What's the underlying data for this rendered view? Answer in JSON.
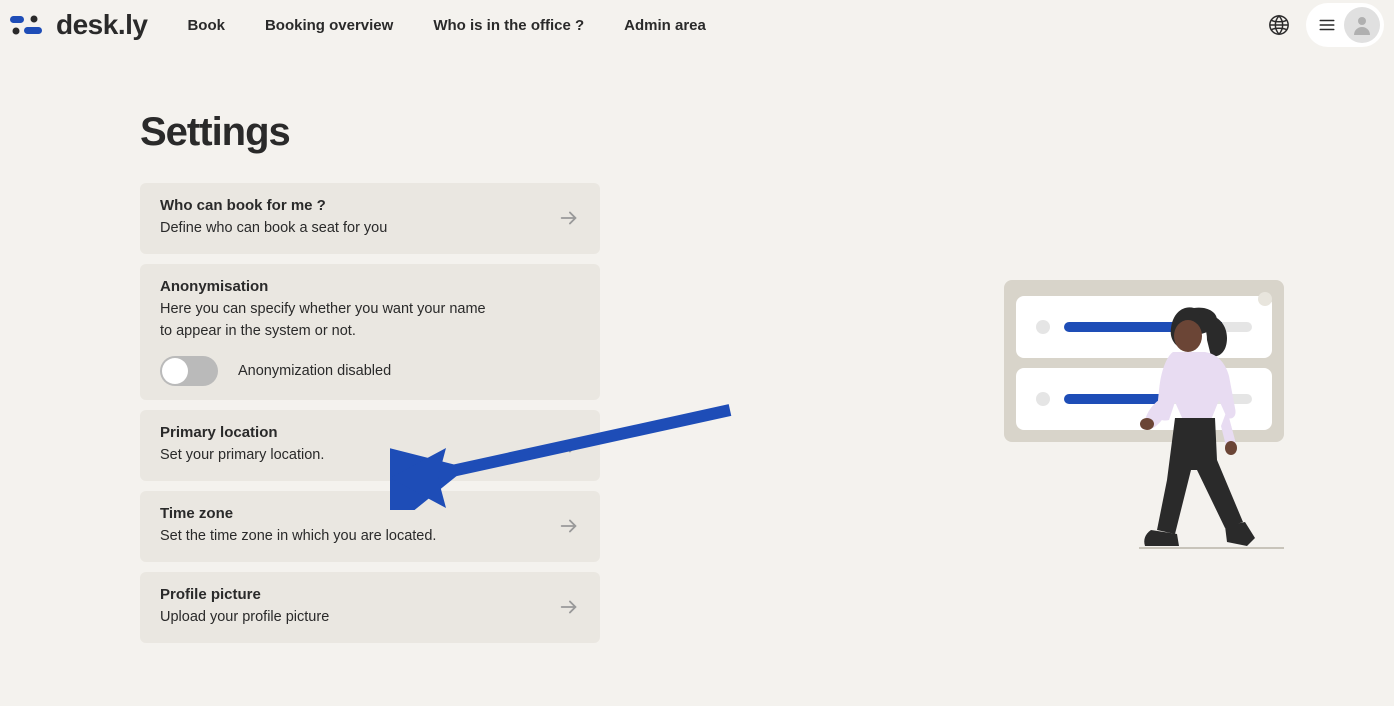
{
  "brand": "desk.ly",
  "nav": {
    "items": [
      {
        "label": "Book"
      },
      {
        "label": "Booking overview"
      },
      {
        "label": "Who is in the office ?"
      },
      {
        "label": "Admin area"
      }
    ]
  },
  "page": {
    "title": "Settings"
  },
  "settings": [
    {
      "id": "who-can-book",
      "title": "Who can book for me ?",
      "desc": "Define who can book a seat for you",
      "hasArrow": true
    },
    {
      "id": "anonymisation",
      "title": "Anonymisation",
      "desc": "Here you can specify whether you want your name to appear in the system or not.",
      "hasToggle": true,
      "toggleLabel": "Anonymization disabled"
    },
    {
      "id": "primary-location",
      "title": "Primary location",
      "desc": "Set your primary location.",
      "hasArrow": true
    },
    {
      "id": "time-zone",
      "title": "Time zone",
      "desc": "Set the time zone in which you are located.",
      "hasArrow": true
    },
    {
      "id": "profile-picture",
      "title": "Profile picture",
      "desc": "Upload your profile picture",
      "hasArrow": true
    }
  ]
}
